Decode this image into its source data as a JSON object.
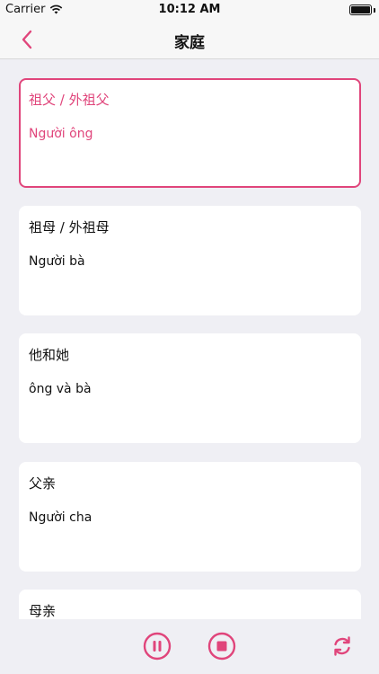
{
  "status_bar": {
    "carrier": "Carrier",
    "time": "10:12 AM"
  },
  "nav": {
    "title": "家庭",
    "back_icon": "chevron-left-icon"
  },
  "accent_color": "#e0457b",
  "cards": [
    {
      "chinese": "祖父 / 外祖父",
      "vietnamese": "Người ông",
      "selected": true
    },
    {
      "chinese": "祖母 / 外祖母",
      "vietnamese": "Người bà",
      "selected": false
    },
    {
      "chinese": "他和她",
      "vietnamese": "ông và bà",
      "selected": false
    },
    {
      "chinese": "父亲",
      "vietnamese": "Người cha",
      "selected": false
    },
    {
      "chinese": "母亲",
      "vietnamese": "",
      "selected": false
    }
  ],
  "controls": {
    "pause_icon": "pause-circle-icon",
    "stop_icon": "stop-circle-icon",
    "repeat_icon": "repeat-icon"
  }
}
